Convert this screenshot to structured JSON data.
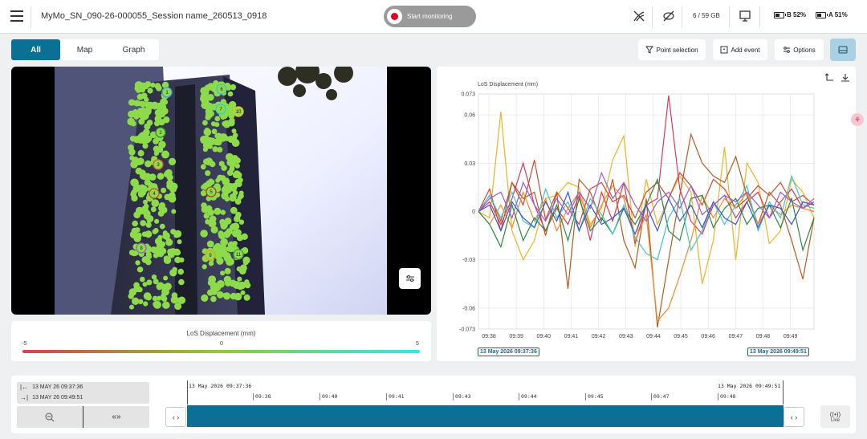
{
  "header": {
    "session_title": "MyMo_SN_090-26-000055_Session name_260513_0918",
    "start_button_label": "Start monitoring",
    "storage": "6 / 59 GB",
    "battery_b": "B 52%",
    "battery_a": "A 51%",
    "battery_b_level": 0.52,
    "battery_a_level": 0.51,
    "record_color": "#e00021",
    "icons": [
      "menu-icon",
      "signal-off-icon",
      "eye-off-icon",
      "monitor-icon"
    ]
  },
  "tabs": [
    {
      "label": "All",
      "active": true
    },
    {
      "label": "Map",
      "active": false
    },
    {
      "label": "Graph",
      "active": false
    }
  ],
  "toolbar": {
    "point_selection": "Point selection",
    "add_event": "Add event",
    "options": "Options",
    "accent": "#0b6f96"
  },
  "image_view": {
    "markers": [
      "1",
      "2",
      "3",
      "4",
      "5",
      "6",
      "7",
      "8",
      "9",
      "10",
      "11"
    ]
  },
  "legend": {
    "title": "LoS Displacement (mm)",
    "min": "-5",
    "mid": "0",
    "max": "5",
    "colors": [
      "#d7404a",
      "#8dcd35",
      "#2fe8ee"
    ]
  },
  "chart_data": {
    "type": "line",
    "ylabel": "LoS Displacement (mm)",
    "ylim": [
      -0.073,
      0.073
    ],
    "y_ticks": [
      "0.073",
      "0.06",
      "0.03",
      "0",
      "-0.03",
      "-0.06",
      "-0.073"
    ],
    "y_tick_values": [
      0.073,
      0.06,
      0.03,
      0,
      -0.03,
      -0.06,
      -0.073
    ],
    "x_ticks": [
      "09:38",
      "09:39",
      "09:40",
      "09:41",
      "09:42",
      "09:43",
      "09:44",
      "09:45",
      "09:46",
      "09:47",
      "09:48",
      "09:49"
    ],
    "x_start_label": "13 May 2026 09:37:36",
    "x_end_label": "13 May 2026 09:49:51",
    "grid": true,
    "series": [
      {
        "color": "#f0b323",
        "values": [
          0,
          -0.004,
          0.062,
          -0.012,
          -0.03,
          -0.018,
          0.008,
          0.01,
          0.018,
          0.015,
          -0.008,
          0.002,
          0.032,
          0.047,
          -0.022,
          0.02,
          -0.008,
          0.008,
          0.022,
          0.012,
          -0.045,
          -0.018,
          0.04,
          -0.03,
          0.03,
          0.018,
          -0.02,
          -0.012,
          0.02,
          0.012,
          -0.004
        ]
      },
      {
        "color": "#d04a30",
        "values": [
          0,
          0.014,
          -0.012,
          0.018,
          0.004,
          0.032,
          -0.005,
          0.012,
          0.002,
          -0.008,
          0.014,
          0.018,
          0.006,
          0.01,
          -0.004,
          0.012,
          0.018,
          0.008,
          0.024,
          0.016,
          0.004,
          0.02,
          0.014,
          0.002,
          0.008,
          0.016,
          0.01,
          0.018,
          0.006,
          0.01,
          0.004
        ]
      },
      {
        "color": "#b85a22",
        "values": [
          0,
          0.01,
          -0.006,
          0.018,
          0.008,
          0.012,
          -0.015,
          0.012,
          -0.048,
          0.02,
          0.012,
          -0.006,
          0.02,
          -0.018,
          -0.035,
          0.008,
          -0.072,
          -0.03,
          0.01,
          0.048,
          0.03,
          0.022,
          0.018,
          0.034,
          0.01,
          -0.008,
          0.012,
          0.004,
          -0.018,
          -0.042,
          -0.004
        ]
      },
      {
        "color": "#e0365a",
        "values": [
          0,
          0.006,
          -0.008,
          0.008,
          0.03,
          0.004,
          -0.012,
          0.002,
          -0.008,
          0.01,
          -0.018,
          0.012,
          -0.006,
          0.018,
          -0.02,
          0.004,
          0.008,
          0.072,
          0.014,
          -0.006,
          -0.014,
          0.004,
          0.01,
          -0.004,
          0.006,
          0.012,
          -0.004,
          0.006,
          0.014,
          0.002,
          0.006
        ]
      },
      {
        "color": "#f28a2e",
        "values": [
          0,
          -0.008,
          0.004,
          -0.01,
          0.012,
          -0.006,
          0.008,
          -0.012,
          0.002,
          0.012,
          -0.01,
          0.004,
          0.016,
          0.008,
          -0.018,
          -0.002,
          -0.068,
          -0.06,
          -0.04,
          -0.018,
          0.01,
          -0.004,
          0.008,
          0.002,
          0.012,
          -0.008,
          0.004,
          -0.002,
          0.004,
          0.002,
          0
        ]
      },
      {
        "color": "#2b8a3e",
        "values": [
          0,
          -0.008,
          -0.022,
          0.004,
          -0.018,
          -0.004,
          -0.012,
          0.004,
          -0.018,
          0.008,
          -0.012,
          -0.004,
          -0.014,
          0.002,
          -0.008,
          0.004,
          0.02,
          -0.012,
          -0.018,
          0.008,
          0.01,
          -0.01,
          0.002,
          0.008,
          -0.008,
          0.002,
          0.004,
          -0.01,
          0.008,
          -0.024,
          -0.004
        ]
      },
      {
        "color": "#3fc6c6",
        "values": [
          0,
          0.01,
          -0.004,
          0.012,
          -0.006,
          -0.01,
          0.014,
          -0.004,
          0.006,
          -0.012,
          0.008,
          -0.002,
          -0.014,
          0.004,
          -0.016,
          -0.026,
          -0.03,
          -0.004,
          0.008,
          -0.024,
          -0.012,
          0.006,
          -0.008,
          0.004,
          0.016,
          -0.012,
          0.006,
          -0.004,
          0.022,
          0.004,
          0.002
        ]
      },
      {
        "color": "#3a55d6",
        "values": [
          0,
          0.004,
          -0.012,
          0.006,
          -0.004,
          -0.01,
          0.006,
          -0.006,
          0.012,
          -0.012,
          0.004,
          -0.008,
          -0.004,
          0.002,
          -0.014,
          0.004,
          -0.012,
          0.008,
          -0.006,
          0.004,
          -0.01,
          0.006,
          -0.004,
          -0.008,
          0.006,
          -0.01,
          0.004,
          0.002,
          -0.008,
          0.006,
          0.004
        ]
      },
      {
        "color": "#9a5bd6",
        "values": [
          0,
          0.008,
          0.012,
          -0.004,
          0.018,
          0.004,
          -0.006,
          0.008,
          -0.002,
          0.012,
          0.002,
          0.024,
          0.008,
          0.018,
          0.004,
          -0.006,
          0.006,
          0.012,
          0.002,
          0.016,
          -0.002,
          0.004,
          0.01,
          0.006,
          0.012,
          0.004,
          -0.004,
          0.012,
          0.006,
          0.002,
          0.008
        ]
      }
    ]
  },
  "timeline": {
    "range_start": "13 MAY 26 09:37:36",
    "range_end": "13 MAY 26 09:49:51",
    "label_start": "13 May 2026 09:37:36",
    "label_end": "13 May 2026 09:49:51",
    "ticks": [
      "09:38",
      "09:40",
      "09:41",
      "09:43",
      "09:44",
      "09:45",
      "09:47",
      "09:48"
    ],
    "jump_label": "«»",
    "nav_label": "‹ ›",
    "live_label": "Live",
    "bar_color": "#0b6f96"
  }
}
